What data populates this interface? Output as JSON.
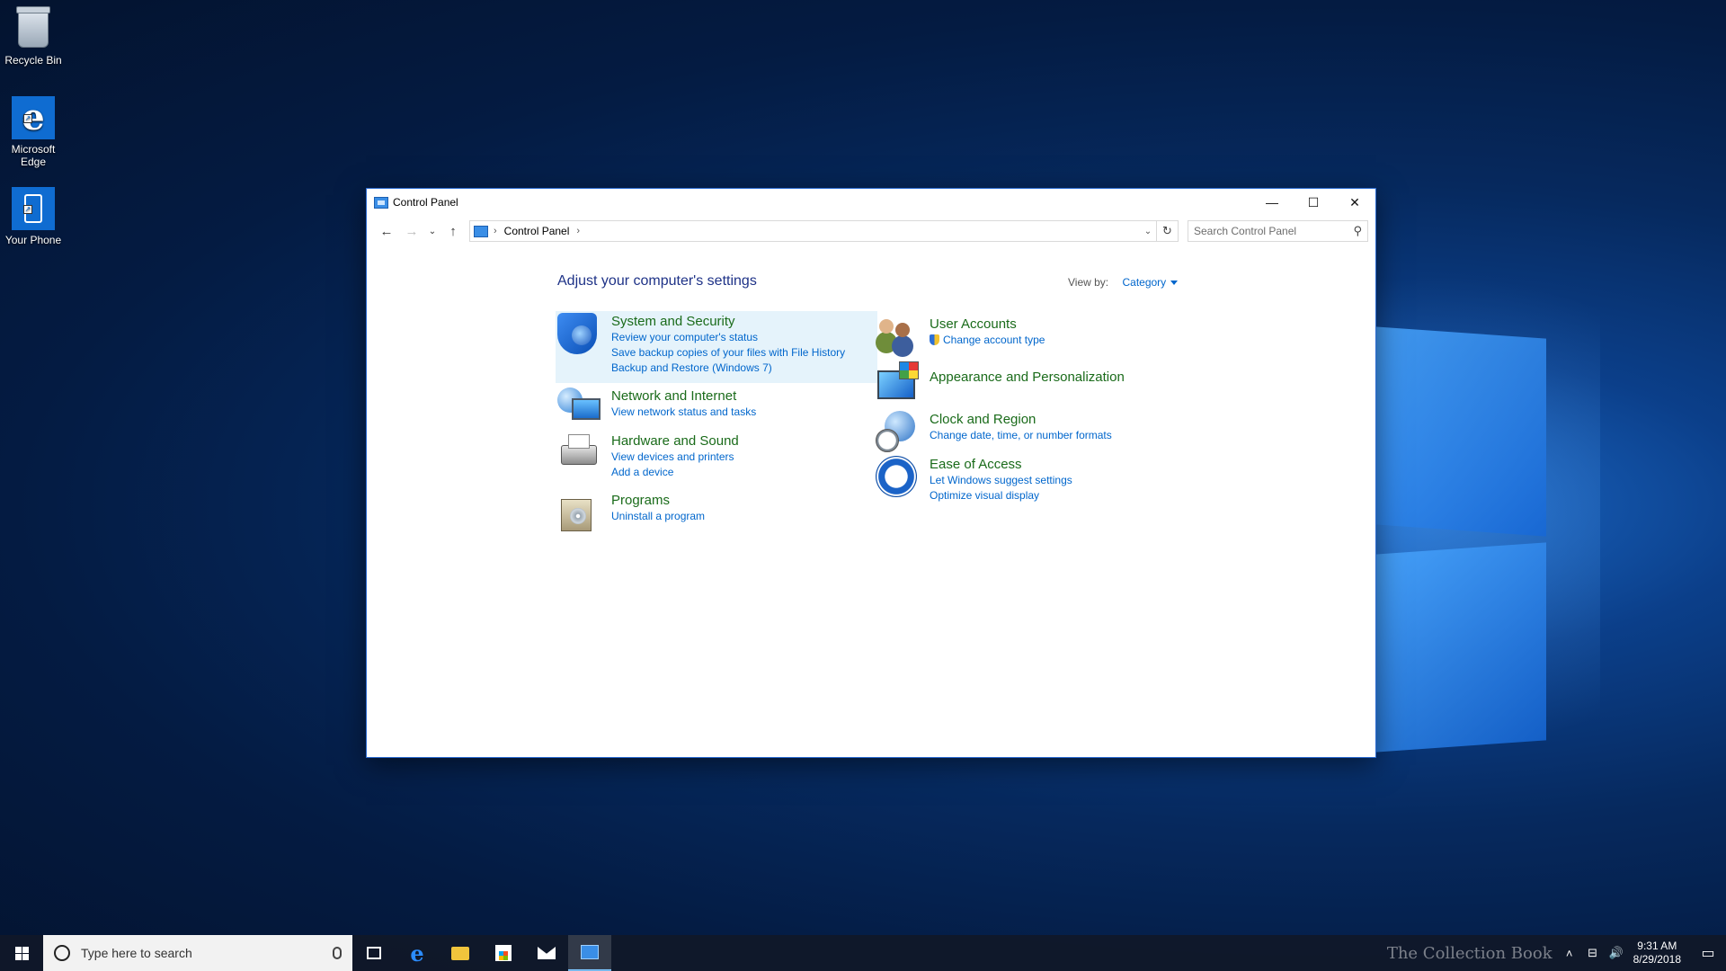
{
  "desktop": {
    "icons": [
      {
        "label": "Recycle Bin",
        "icon": "recycle-bin-icon"
      },
      {
        "label": "Microsoft Edge",
        "icon": "edge-icon"
      },
      {
        "label": "Your Phone",
        "icon": "phone-icon"
      }
    ]
  },
  "window": {
    "title": "Control Panel",
    "controls": {
      "minimize": "—",
      "maximize": "☐",
      "close": "✕"
    },
    "nav": {
      "back": "←",
      "forward": "→",
      "recent": "⌄",
      "up": "↑"
    },
    "address": {
      "separator": "›",
      "crumbs": [
        "Control Panel"
      ],
      "dropdown": "⌄",
      "refresh": "↻"
    },
    "search": {
      "placeholder": "Search Control Panel",
      "value": ""
    },
    "heading": "Adjust your computer's settings",
    "view_by": {
      "label": "View by:",
      "value": "Category"
    },
    "categories_left": [
      {
        "name": "System and Security",
        "icon": "shield-icon",
        "links": [
          "Review your computer's status",
          "Save backup copies of your files with File History",
          "Backup and Restore (Windows 7)"
        ]
      },
      {
        "name": "Network and Internet",
        "icon": "network-icon",
        "links": [
          "View network status and tasks"
        ]
      },
      {
        "name": "Hardware and Sound",
        "icon": "printer-icon",
        "links": [
          "View devices and printers",
          "Add a device"
        ]
      },
      {
        "name": "Programs",
        "icon": "programs-icon",
        "links": [
          "Uninstall a program"
        ]
      }
    ],
    "categories_right": [
      {
        "name": "User Accounts",
        "icon": "users-icon",
        "links": [
          "Change account type"
        ]
      },
      {
        "name": "Appearance and Personalization",
        "icon": "appearance-icon",
        "links": []
      },
      {
        "name": "Clock and Region",
        "icon": "clock-icon",
        "links": [
          "Change date, time, or number formats"
        ]
      },
      {
        "name": "Ease of Access",
        "icon": "ease-of-access-icon",
        "links": [
          "Let Windows suggest settings",
          "Optimize visual display"
        ]
      }
    ]
  },
  "taskbar": {
    "search_placeholder": "Type here to search",
    "watermark": "The Collection Book",
    "time": "9:31 AM",
    "date": "8/29/2018"
  },
  "colors": {
    "category_name": "#1a6b1a",
    "link": "#0066cc",
    "heading": "#1e3287",
    "hover_bg": "#e5f3fb"
  }
}
